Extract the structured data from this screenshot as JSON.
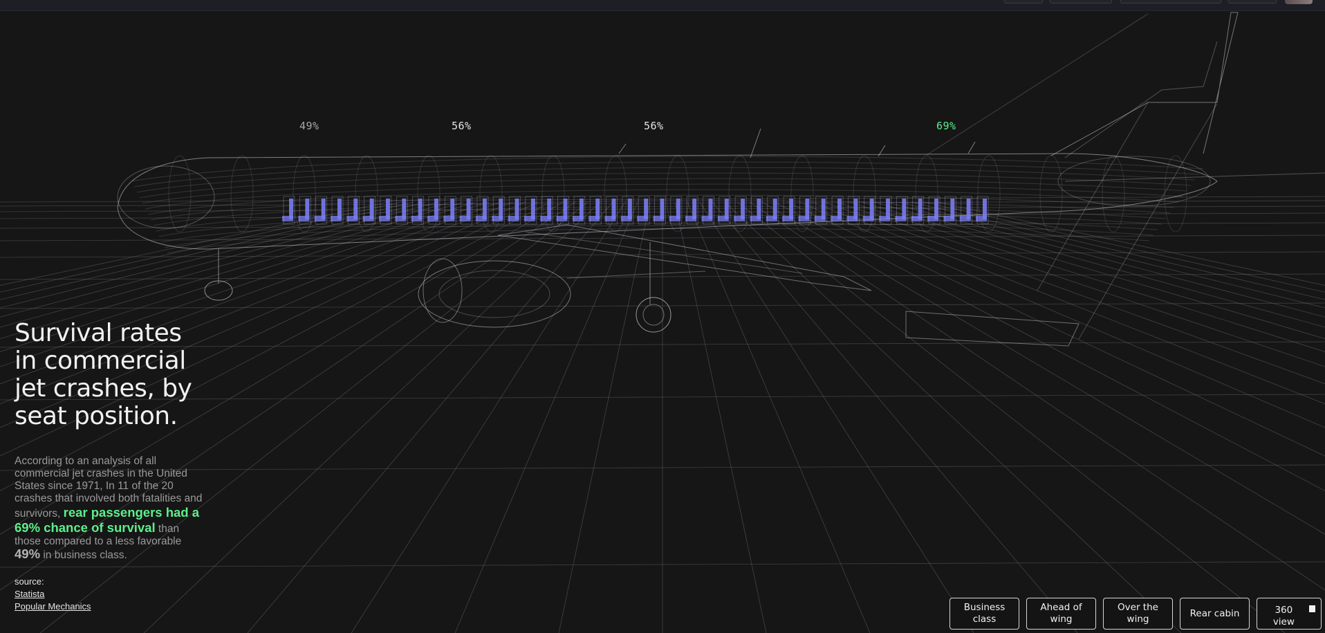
{
  "scene": {
    "zone_labels": [
      {
        "text": "49%",
        "tone": "dim"
      },
      {
        "text": "56%",
        "tone": "mid"
      },
      {
        "text": "56%",
        "tone": "mid"
      },
      {
        "text": "69%",
        "tone": "highlight"
      }
    ],
    "colors": {
      "background": "#161616",
      "wireframe": "#c8c8d2",
      "seats": "#7a7cf0",
      "highlight": "#5cf08c",
      "grid": "#6a6a6a"
    }
  },
  "info": {
    "title": "Survival rates in commercial jet crashes, by seat position.",
    "desc_intro": "According to an analysis of all commercial jet crashes in the United States since 1971, In 11 of the 20 crashes that involved both fatalities and survivors, ",
    "desc_highlight": "rear passengers had a 69% chance of survival",
    "desc_middle": " than those compared to a less favorable ",
    "desc_number": "49%",
    "desc_end": " in business class.",
    "source_label": "source:",
    "sources": [
      "Statista",
      "Popular Mechanics"
    ]
  },
  "controls": {
    "business_class": "Business class",
    "ahead_of_wing": "Ahead of wing",
    "over_the_wing": "Over the wing",
    "rear_cabin": "Rear cabin",
    "view_360": "360 view",
    "view_360_checked": true
  }
}
